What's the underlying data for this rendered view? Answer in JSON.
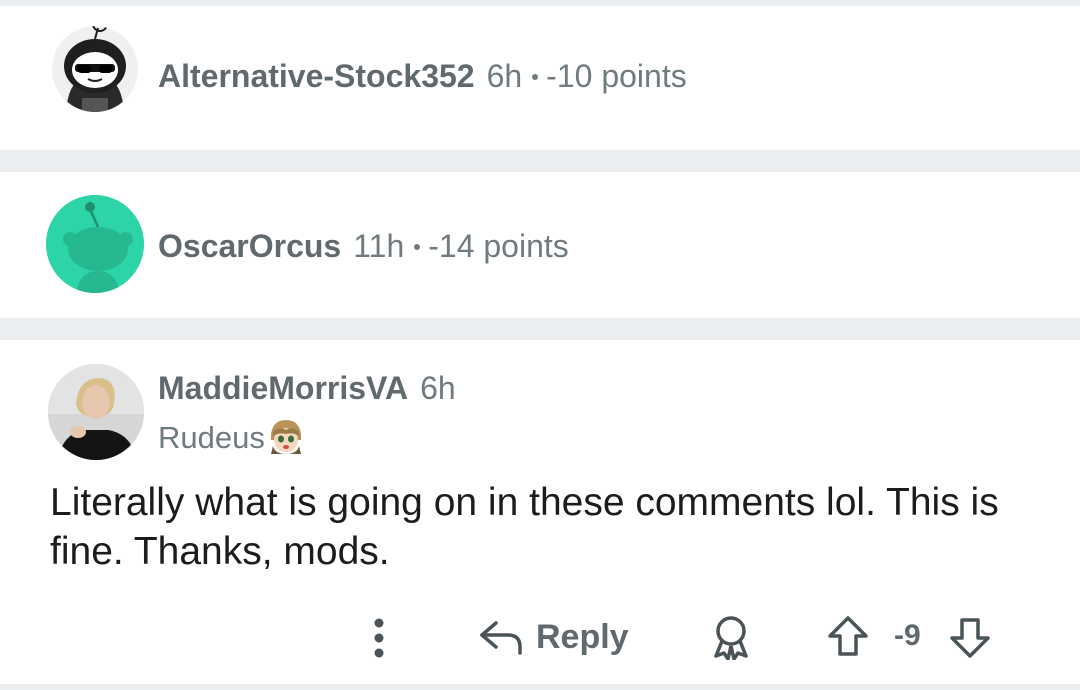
{
  "comments": [
    {
      "username": "Alternative-Stock352",
      "age": "6h",
      "points": "-10 points",
      "collapsed": true,
      "avatar_icon": "snoo-hooded-sunglasses-avatar"
    },
    {
      "username": "OscarOrcus",
      "age": "11h",
      "points": "-14 points",
      "collapsed": true,
      "avatar_icon": "snoo-default-teal-avatar"
    },
    {
      "username": "MaddieMorrisVA",
      "age": "6h",
      "flair": "Rudeus",
      "flair_icon": "rudeus-anime-emoji",
      "body": "Literally what is going on in these comments lol. This is fine. Thanks, mods.",
      "collapsed": false,
      "avatar_icon": "user-photo-avatar"
    }
  ],
  "actions": {
    "more_icon": "vertical-ellipsis-icon",
    "reply_icon": "reply-arrow-icon",
    "reply_label": "Reply",
    "award_icon": "award-icon",
    "upvote_icon": "upvote-arrow-icon",
    "score": "-9",
    "downvote_icon": "downvote-arrow-icon"
  },
  "colors": {
    "divider": "#eceff1",
    "meta_text": "#707b80",
    "username_text": "#60696e",
    "body_text": "#1c1c1c",
    "teal_avatar": "#2dd4a8"
  }
}
